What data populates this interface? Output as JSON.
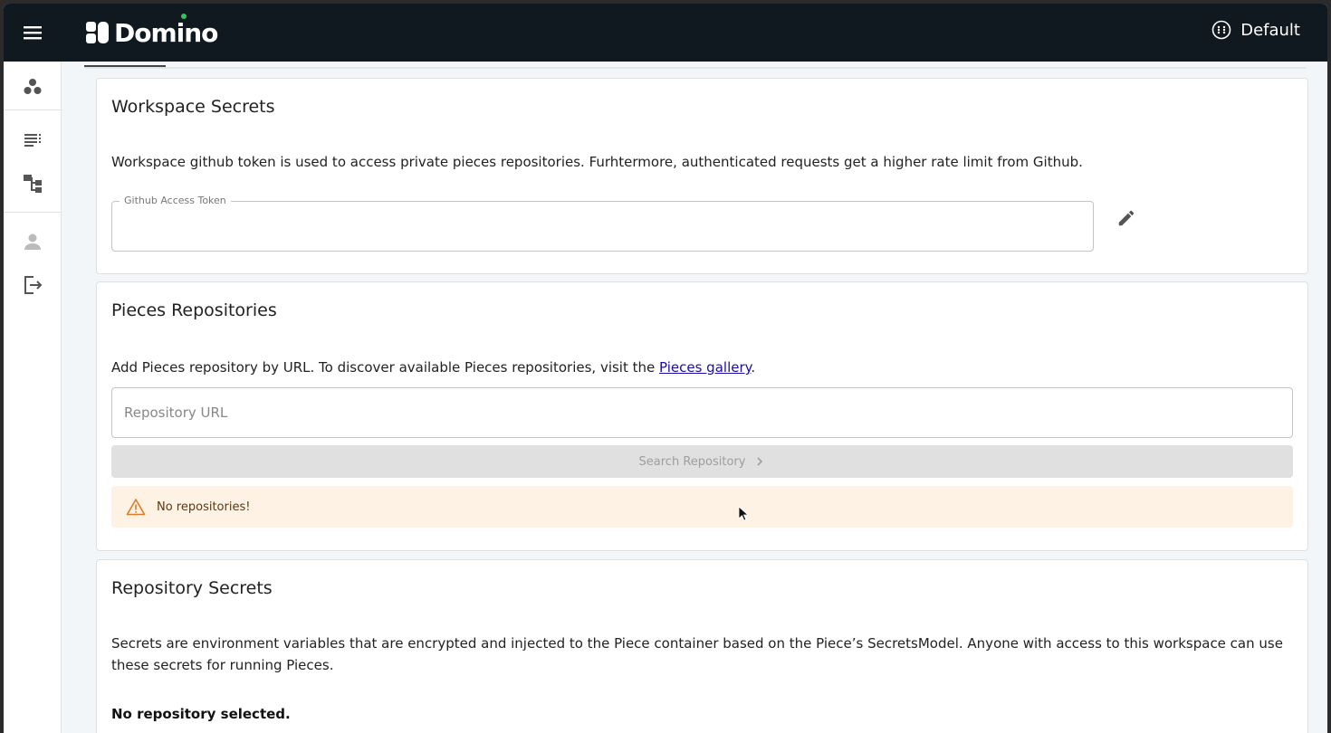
{
  "header": {
    "brand": "Domino",
    "workspace_label": "Default"
  },
  "sidebar": {
    "items": [
      {
        "icon": "workspaces-icon"
      },
      {
        "icon": "list-icon"
      },
      {
        "icon": "flow-icon"
      },
      {
        "icon": "person-icon"
      },
      {
        "icon": "logout-icon"
      }
    ]
  },
  "workspace_secrets": {
    "title": "Workspace Secrets",
    "description": "Workspace github token is used to access private pieces repositories. Furhtermore, authenticated requests get a higher rate limit from Github.",
    "token_label": "Github Access Token",
    "token_value": ""
  },
  "pieces_repositories": {
    "title": "Pieces Repositories",
    "description_prefix": "Add Pieces repository by URL. To discover available Pieces repositories, visit the ",
    "gallery_link": "Pieces gallery",
    "description_suffix": ".",
    "url_placeholder": "Repository URL",
    "search_button": "Search Repository",
    "alert_text": "No repositories!"
  },
  "repository_secrets": {
    "title": "Repository Secrets",
    "description": "Secrets are environment variables that are encrypted and injected to the Piece container based on the Piece’s SecretsModel. Anyone with access to this workspace can use these secrets for running Pieces.",
    "empty_text": "No repository selected."
  },
  "colors": {
    "appbar": "#101820",
    "alert_bg": "#fdf2e4",
    "alert_icon": "#e07b24",
    "link": "#1a0dab"
  }
}
